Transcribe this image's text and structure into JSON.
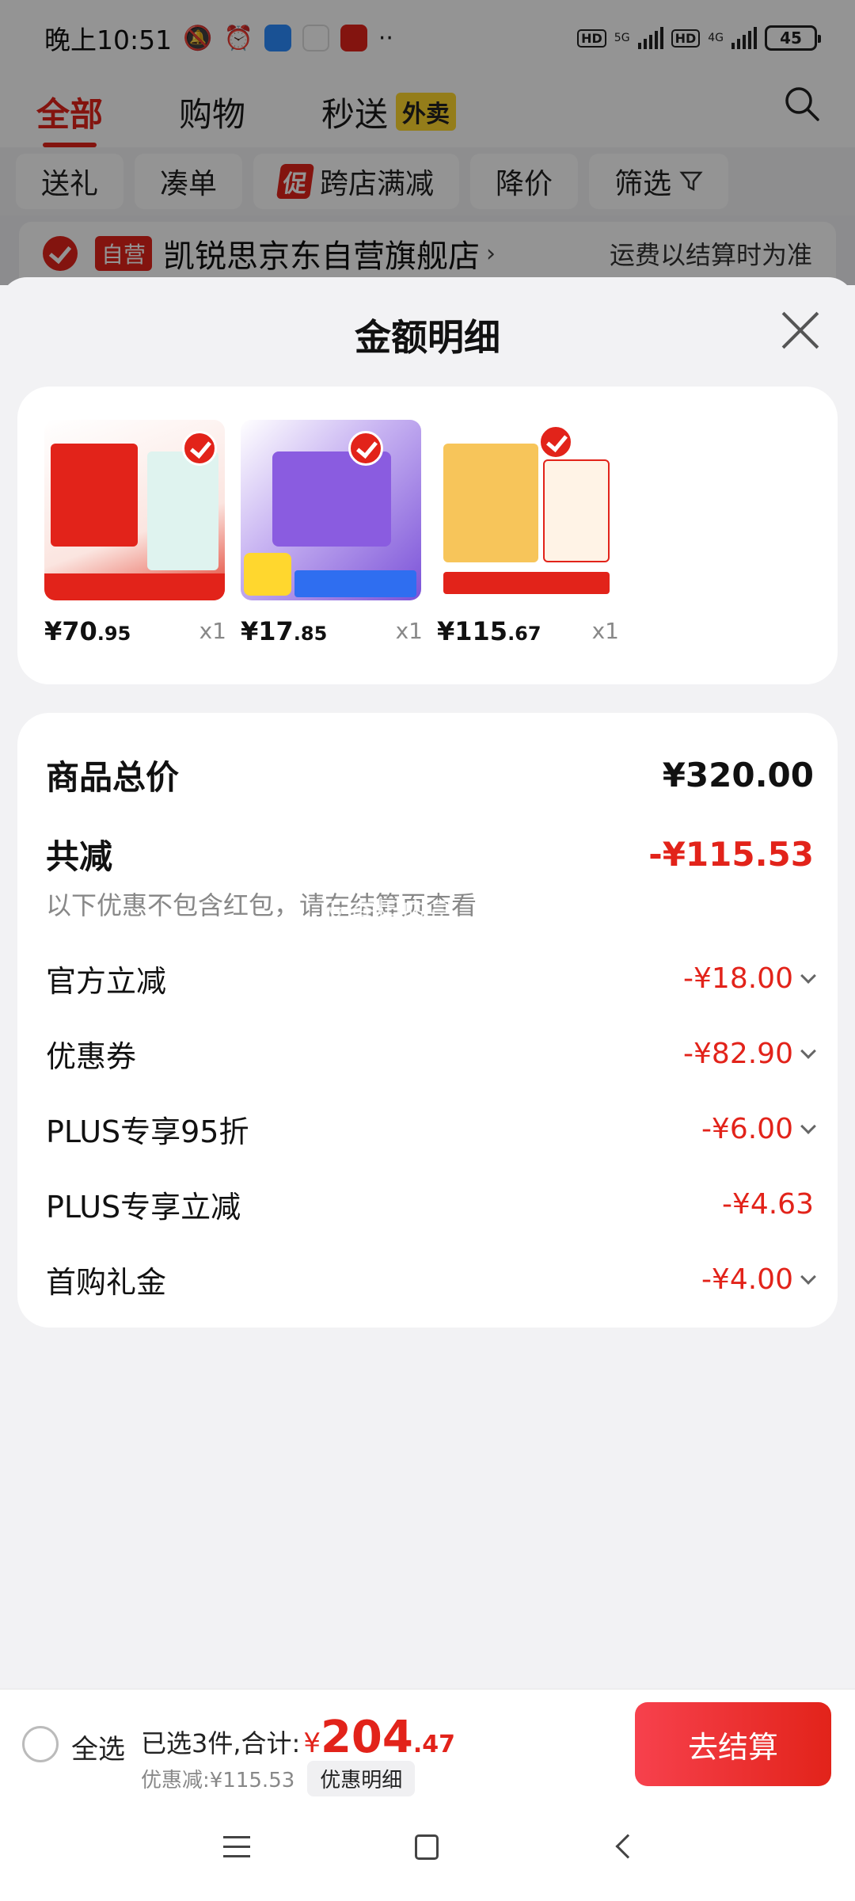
{
  "status_bar": {
    "time": "晚上10:51",
    "network_1": "5G",
    "network_2": "4G",
    "hd_label": "HD",
    "battery": "45",
    "icons": [
      "mute-bell-icon",
      "alarm-icon",
      "app-stack-icon",
      "play-store-icon",
      "app-icon",
      "more-dots-icon",
      "signal-icon",
      "battery-icon"
    ]
  },
  "top_tabs": {
    "items": [
      "全部",
      "购物",
      "秒送"
    ],
    "active": "全部",
    "badge": "外卖"
  },
  "filters": {
    "chips": [
      "送礼",
      "凑单",
      "跨店满减",
      "降价",
      "筛选"
    ],
    "promo_badge": "促"
  },
  "store": {
    "badge": "自营",
    "name": "凯锐思京东自营旗舰店",
    "shipping_note": "运费以结算时为准"
  },
  "sheet": {
    "title": "金额明细",
    "items": [
      {
        "price_int": "¥70",
        "price_dec": ".95",
        "qty": "x1"
      },
      {
        "price_int": "¥17",
        "price_dec": ".85",
        "qty": "x1"
      },
      {
        "price_int": "¥115",
        "price_dec": ".67",
        "qty": "x1"
      }
    ],
    "summary": {
      "total_label": "商品总价",
      "total_value": "¥320.00",
      "discount_label": "共减",
      "discount_value": "-¥115.53",
      "note": "以下优惠不包含红包，请在结算页查看",
      "rows": [
        {
          "label": "官方立减",
          "value": "-¥18.00",
          "expandable": true
        },
        {
          "label": "优惠券",
          "value": "-¥82.90",
          "expandable": true
        },
        {
          "label": "PLUS专享95折",
          "value": "-¥6.00",
          "expandable": true
        },
        {
          "label": "PLUS专享立减",
          "value": "-¥4.63",
          "expandable": false
        },
        {
          "label": "首购礼金",
          "value": "-¥4.00",
          "expandable": true
        }
      ]
    },
    "watermark": "反查相应员"
  },
  "bottom_bar": {
    "select_all": "全选",
    "selected_text": "已选3件,合计:",
    "yen": "¥",
    "amount_int": "204",
    "amount_dec": ".47",
    "discount_text": "优惠减:¥115.53",
    "detail_button": "优惠明细",
    "checkout_button": "去结算"
  },
  "colors": {
    "accent": "#e2231a",
    "badge_yellow": "#ffd72e",
    "background": "#f2f2f4"
  }
}
